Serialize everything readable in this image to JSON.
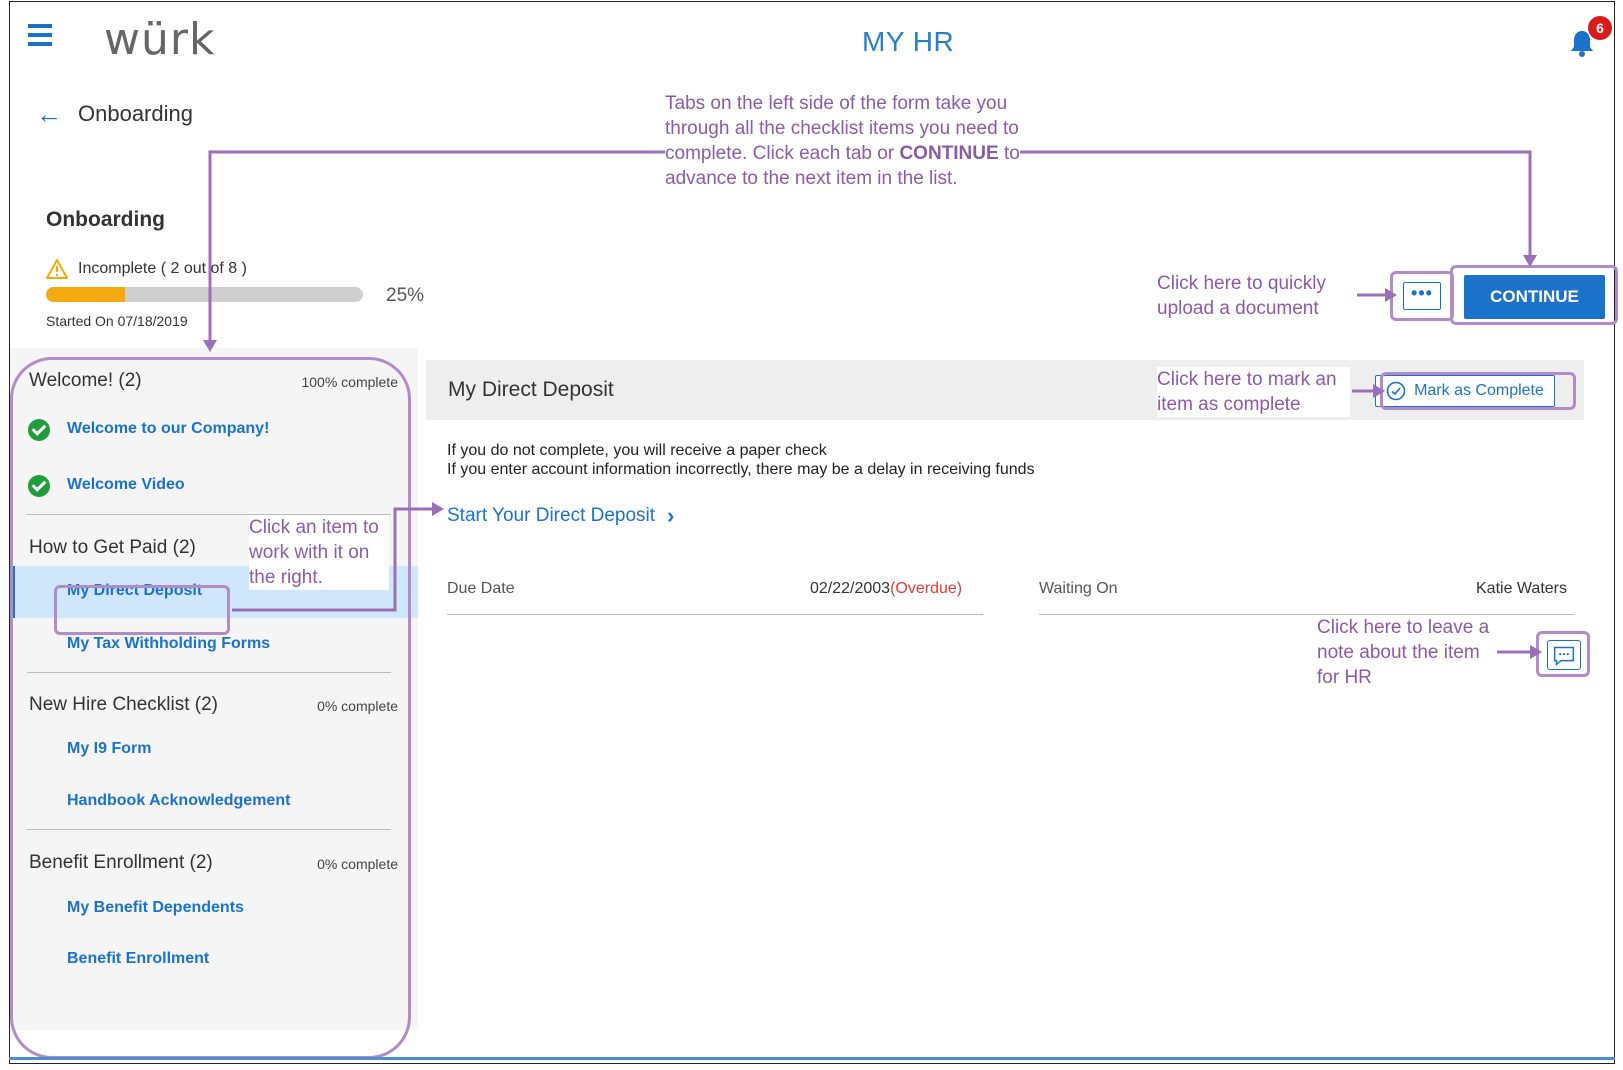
{
  "header": {
    "logo": "würk",
    "title": "MY HR",
    "notification_count": "6",
    "icons": [
      "hamburger-menu-icon",
      "bell-icon"
    ]
  },
  "nav": {
    "back_label": "Onboarding"
  },
  "onboarding": {
    "title": "Onboarding",
    "status": "Incomplete ( 2 out of 8 )",
    "progress_fraction": 0.25,
    "progress_label": "25%",
    "started": "Started On 07/18/2019"
  },
  "sidebar": {
    "sections": [
      {
        "heading": "Welcome! (2)",
        "percent": "100% complete",
        "items": [
          {
            "label": "Welcome to our Company!",
            "completed": true
          },
          {
            "label": "Welcome Video",
            "completed": true
          }
        ]
      },
      {
        "heading": "How to Get Paid (2)",
        "percent": "",
        "items": [
          {
            "label": "My Direct Deposit",
            "completed": false,
            "active": true
          },
          {
            "label": "My Tax Withholding Forms",
            "completed": false
          }
        ]
      },
      {
        "heading": "New Hire Checklist (2)",
        "percent": "0% complete",
        "items": [
          {
            "label": "My I9 Form",
            "completed": false
          },
          {
            "label": "Handbook Acknowledgement",
            "completed": false
          }
        ]
      },
      {
        "heading": "Benefit Enrollment (2)",
        "percent": "0% complete",
        "items": [
          {
            "label": "My Benefit Dependents",
            "completed": false
          },
          {
            "label": "Benefit Enrollment",
            "completed": false
          }
        ]
      }
    ]
  },
  "panel": {
    "title": "My Direct Deposit",
    "mark_complete_label": "Mark as Complete",
    "info_lines": [
      "If you do not complete, you will receive a paper check",
      "If you enter account information incorrectly, there may be a delay in receiving funds"
    ],
    "start_link": "Start Your Direct Deposit",
    "due_date_label": "Due Date",
    "due_date_value": "02/22/2003",
    "overdue_label": "(Overdue)",
    "waiting_on_label": "Waiting On",
    "waiting_on_value": "Katie Waters"
  },
  "actions": {
    "more_label": "•••",
    "continue_label": "CONTINUE"
  },
  "callouts": {
    "tabs_pre": "Tabs on the left side of the form take you through all the checklist items you need to complete. Click each tab or ",
    "tabs_bold": "CONTINUE",
    "tabs_post": " to advance to the next item in the list.",
    "upload": "Click here to quickly upload a document",
    "mark": "Click here to mark an item as complete",
    "item": "Click an item to work with it on the right.",
    "note": "Click here to leave a note about the item for HR"
  },
  "colors": {
    "accent": "#1a73c8",
    "annotation": "#8c5ba8",
    "progress": "#f6a90f",
    "overdue": "#e53935",
    "success": "#1e9e3c"
  }
}
